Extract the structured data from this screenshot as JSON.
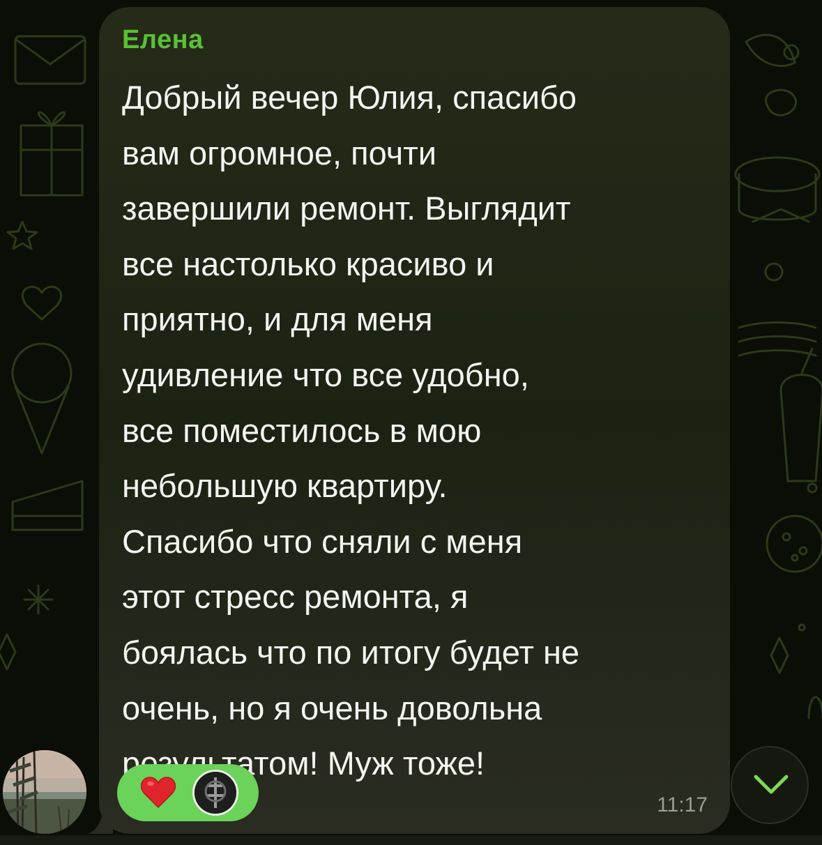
{
  "message": {
    "sender": "Елена",
    "text": "Добрый вечер Юлия, спасибо\nвам огромное, почти\nзавершили ремонт. Выглядит\nвсе настолько красиво и\nприятно, и для меня\nудивление что все удобно,\nвсе поместилось в мою\nнебольшую квартиру.\nСпасибо что сняли с меня\nэтот стресс ремонта, я\nбоялась что по итогу будет не\nочень, но я очень довольна\nрезультатом! Муж тоже!",
    "time": "11:17",
    "reaction": {
      "emoji_icon": "heart-icon",
      "color": "#6bd25a"
    }
  },
  "colors": {
    "sender_name": "#59c135",
    "bubble": "#1f2414",
    "background": "#0b0d07"
  },
  "icons": [
    "heart-icon",
    "chevron-down-icon"
  ]
}
